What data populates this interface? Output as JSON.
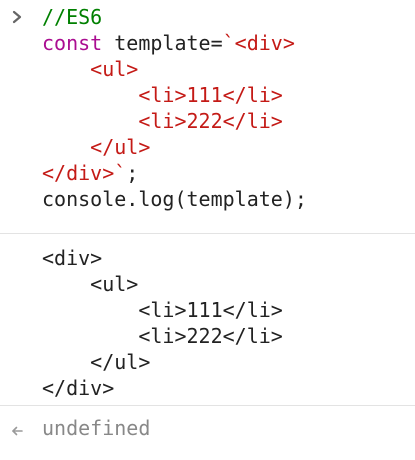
{
  "input": {
    "prompt_icon": "chevron-right-icon",
    "lines": [
      [
        {
          "t": "//ES6",
          "c": "comment"
        }
      ],
      [
        {
          "t": "const",
          "c": "keyword"
        },
        {
          "t": " template=",
          "c": "plain"
        },
        {
          "t": "`<div>",
          "c": "tag"
        }
      ],
      [
        {
          "t": "    <ul>",
          "c": "tag"
        }
      ],
      [
        {
          "t": "        <li>111</li>",
          "c": "tag"
        }
      ],
      [
        {
          "t": "        <li>222</li>",
          "c": "tag"
        }
      ],
      [
        {
          "t": "    </ul>",
          "c": "tag"
        }
      ],
      [
        {
          "t": "</div>`",
          "c": "tag"
        },
        {
          "t": ";",
          "c": "plain"
        }
      ],
      [
        {
          "t": "console.log(template);",
          "c": "plain"
        }
      ]
    ]
  },
  "output": {
    "lines": [
      "<div>",
      "    <ul>",
      "        <li>111</li>",
      "        <li>222</li>",
      "    </ul>",
      "</div>"
    ]
  },
  "result": {
    "icon": "return-arrow-icon",
    "value": "undefined"
  },
  "colors": {
    "comment": "#008000",
    "keyword": "#aa0d91",
    "tag": "#c41a16",
    "plain": "#222222",
    "muted": "#888888"
  }
}
